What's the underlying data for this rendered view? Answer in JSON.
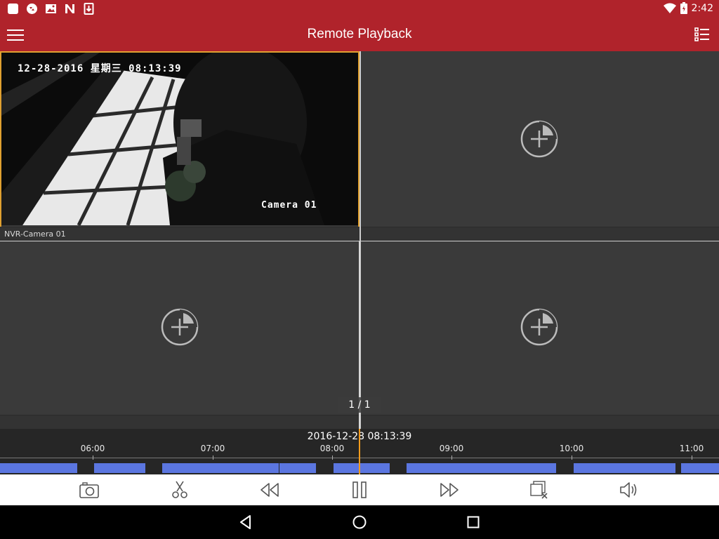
{
  "status_bar": {
    "time": "2:42",
    "left_icons": [
      "app-icon",
      "sync-icon",
      "image-icon",
      "nfc-icon",
      "download-icon"
    ],
    "right_icons": [
      "wifi-icon",
      "battery-icon"
    ]
  },
  "app_bar": {
    "title": "Remote Playback",
    "menu_icon": "menu-icon",
    "list_icon": "channel-list-icon"
  },
  "video_grid": {
    "page_indicator": "1 / 1",
    "cells": [
      {
        "label": "NVR-Camera 01",
        "osd_datetime": "12-28-2016 星期三 08:13:39",
        "osd_camera": "Camera 01",
        "selected": true
      },
      {
        "label": "",
        "empty": true
      },
      {
        "label": "",
        "empty": true
      },
      {
        "label": "",
        "empty": true
      }
    ]
  },
  "timeline": {
    "current_datetime": "2016-12-28 08:13:39",
    "hour_labels": [
      "06:00",
      "07:00",
      "08:00",
      "09:00",
      "10:00",
      "11:00"
    ],
    "accent_color": "#5b76e0",
    "cursor_color": "#f29b1e"
  },
  "controls": [
    "capture-icon",
    "clip-icon",
    "rewind-icon",
    "pause-icon",
    "fast-forward-icon",
    "stop-all-icon",
    "audio-icon"
  ],
  "nav_bar": [
    "back-icon",
    "home-icon",
    "recents-icon"
  ]
}
